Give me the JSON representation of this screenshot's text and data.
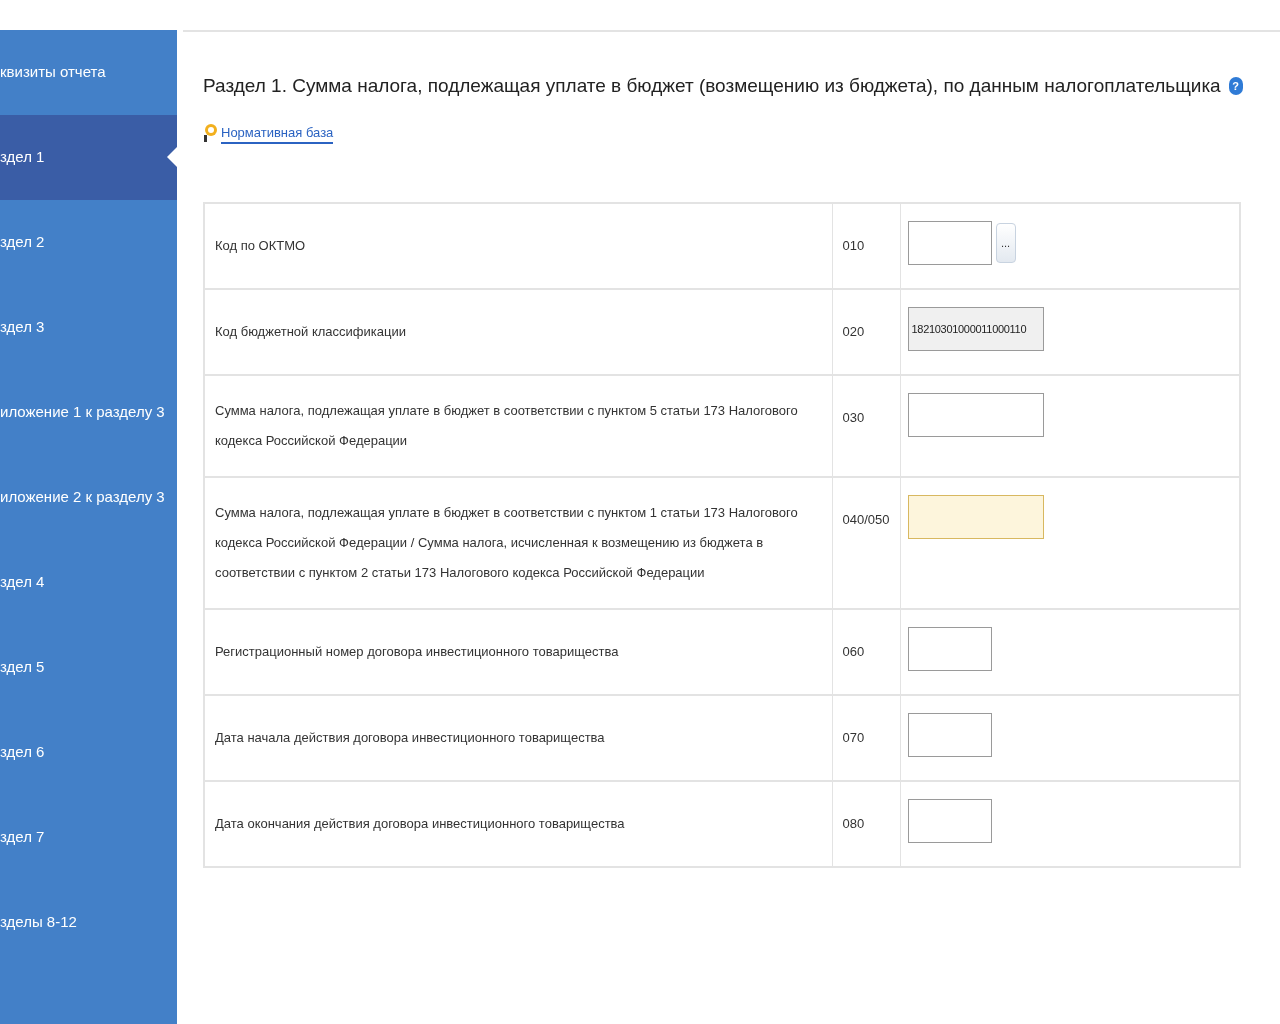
{
  "sidebar": {
    "items": [
      {
        "label": "квизиты отчета",
        "selected": false
      },
      {
        "label": "здел 1",
        "selected": true
      },
      {
        "label": "здел 2",
        "selected": false
      },
      {
        "label": "здел 3",
        "selected": false
      },
      {
        "label": "иложение 1 к разделу 3",
        "selected": false
      },
      {
        "label": "иложение 2 к разделу 3",
        "selected": false
      },
      {
        "label": "здел 4",
        "selected": false
      },
      {
        "label": "здел 5",
        "selected": false
      },
      {
        "label": "здел 6",
        "selected": false
      },
      {
        "label": "здел 7",
        "selected": false
      },
      {
        "label": "зделы 8-12",
        "selected": false
      }
    ]
  },
  "title": "Раздел 1. Сумма налога, подлежащая уплате в бюджет (возмещению из бюджета), по данным налогоплательщика",
  "help_icon": "?",
  "reference_link": "Нормативная база",
  "rows": [
    {
      "label": "Код по ОКТМО",
      "code": "010",
      "field": {
        "kind": "lookup",
        "button_label": "..."
      }
    },
    {
      "label": "Код бюджетной классификации",
      "code": "020",
      "field": {
        "kind": "readonly",
        "value": "18210301000011000110"
      }
    },
    {
      "label": "Сумма налога, подлежащая уплате в бюджет в соответствии с пунктом 5 статьи 173 Налогового кодекса Российской Федерации",
      "code": "030",
      "field": {
        "kind": "wide"
      }
    },
    {
      "label": "Сумма налога, подлежащая уплате в бюджет в соответствии с пунктом 1 статьи 173 Налогового кодекса Российской Федерации / Сумма налога, исчисленная к возмещению из бюджета в соответствии с пунктом 2 статьи 173 Налогового кодекса Российской Федерации",
      "code": "040/050",
      "field": {
        "kind": "highlighted"
      }
    },
    {
      "label": "Регистрационный номер договора инвестиционного товарищества",
      "code": "060",
      "field": {
        "kind": "short"
      }
    },
    {
      "label": "Дата начала действия договора инвестиционного товарищества",
      "code": "070",
      "field": {
        "kind": "short"
      }
    },
    {
      "label": "Дата окончания действия договора инвестиционного товарищества",
      "code": "080",
      "field": {
        "kind": "short"
      }
    }
  ]
}
